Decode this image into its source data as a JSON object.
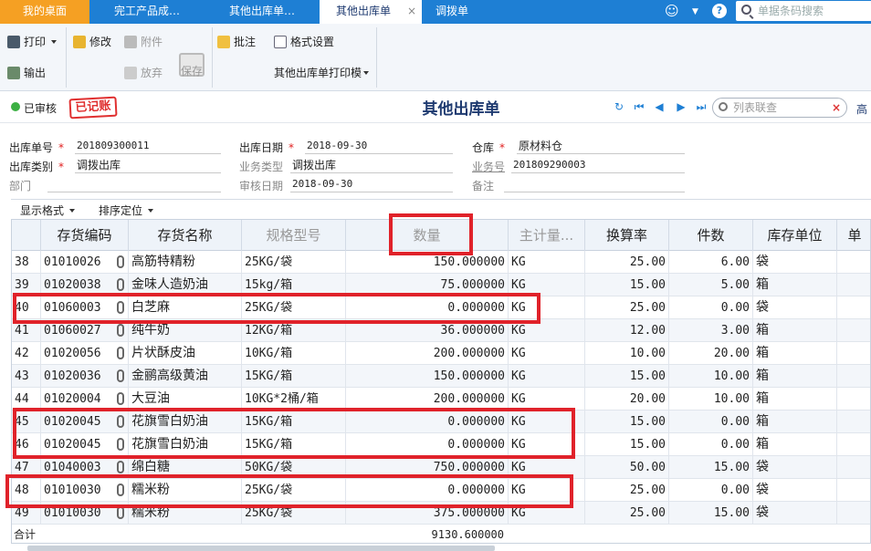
{
  "tabs": [
    {
      "label": "我的桌面"
    },
    {
      "label": "完工产品成…"
    },
    {
      "label": "其他出库单…"
    },
    {
      "label": "其他出库单"
    },
    {
      "label": "调拨单"
    }
  ],
  "top_search_placeholder": "单据条码搜索",
  "toolbar": {
    "print": "打印",
    "edit": "修改",
    "attach": "附件",
    "save": "保存",
    "annotate": "批注",
    "format": "格式设置",
    "output": "输出",
    "discard": "放弃",
    "print_template": "其他出库单打印模"
  },
  "status": {
    "audited": "已审核",
    "stamp": "已记账",
    "title": "其他出库单",
    "link_search_placeholder": "列表联查",
    "right_cut": "高"
  },
  "form": {
    "doc_no_label": "出库单号",
    "doc_no": "201809300011",
    "date_label": "出库日期",
    "date": "2018-09-30",
    "warehouse_label": "仓库",
    "warehouse": "原材料仓",
    "type_label": "出库类别",
    "type": "调拨出库",
    "biz_type_label": "业务类型",
    "biz_type": "调拨出库",
    "biz_no_label": "业务号",
    "biz_no": "201809290003",
    "dept_label": "部门",
    "dept": "",
    "audit_date_label": "审核日期",
    "audit_date": "2018-09-30",
    "note_label": "备注",
    "note": ""
  },
  "grid_tools": {
    "display_format": "显示格式",
    "sort_locate": "排序定位"
  },
  "columns": [
    "",
    "存货编码",
    "存货名称",
    "规格型号",
    "数量",
    "主计量...",
    "换算率",
    "件数",
    "库存单位",
    "单"
  ],
  "rows": [
    {
      "no": "38",
      "code": "01010026",
      "name": "高筋特精粉",
      "spec": "25KG/袋",
      "qty": "150.000000",
      "unit": "KG",
      "rate": "25.00",
      "pieces": "6.00",
      "stock_unit": "袋"
    },
    {
      "no": "39",
      "code": "01020038",
      "name": "金味人造奶油",
      "spec": "15kg/箱",
      "qty": "75.000000",
      "unit": "KG",
      "rate": "15.00",
      "pieces": "5.00",
      "stock_unit": "箱"
    },
    {
      "no": "40",
      "code": "01060003",
      "name": "白芝麻",
      "spec": "25KG/袋",
      "qty": "0.000000",
      "unit": "KG",
      "rate": "25.00",
      "pieces": "0.00",
      "stock_unit": "袋"
    },
    {
      "no": "41",
      "code": "01060027",
      "name": "纯牛奶",
      "spec": "12KG/箱",
      "qty": "36.000000",
      "unit": "KG",
      "rate": "12.00",
      "pieces": "3.00",
      "stock_unit": "箱"
    },
    {
      "no": "42",
      "code": "01020056",
      "name": "片状酥皮油",
      "spec": "10KG/箱",
      "qty": "200.000000",
      "unit": "KG",
      "rate": "10.00",
      "pieces": "20.00",
      "stock_unit": "箱"
    },
    {
      "no": "43",
      "code": "01020036",
      "name": "金鹂高级黄油",
      "spec": "15KG/箱",
      "qty": "150.000000",
      "unit": "KG",
      "rate": "15.00",
      "pieces": "10.00",
      "stock_unit": "箱"
    },
    {
      "no": "44",
      "code": "01020004",
      "name": "大豆油",
      "spec": "10KG*2桶/箱",
      "qty": "200.000000",
      "unit": "KG",
      "rate": "20.00",
      "pieces": "10.00",
      "stock_unit": "箱"
    },
    {
      "no": "45",
      "code": "01020045",
      "name": "花旗雪白奶油",
      "spec": "15KG/箱",
      "qty": "0.000000",
      "unit": "KG",
      "rate": "15.00",
      "pieces": "0.00",
      "stock_unit": "箱"
    },
    {
      "no": "46",
      "code": "01020045",
      "name": "花旗雪白奶油",
      "spec": "15KG/箱",
      "qty": "0.000000",
      "unit": "KG",
      "rate": "15.00",
      "pieces": "0.00",
      "stock_unit": "箱"
    },
    {
      "no": "47",
      "code": "01040003",
      "name": "绵白糖",
      "spec": "50KG/袋",
      "qty": "750.000000",
      "unit": "KG",
      "rate": "50.00",
      "pieces": "15.00",
      "stock_unit": "袋"
    },
    {
      "no": "48",
      "code": "01010030",
      "name": "糯米粉",
      "spec": "25KG/袋",
      "qty": "0.000000",
      "unit": "KG",
      "rate": "25.00",
      "pieces": "0.00",
      "stock_unit": "袋"
    },
    {
      "no": "49",
      "code": "01010030",
      "name": "糯米粉",
      "spec": "25KG/袋",
      "qty": "375.000000",
      "unit": "KG",
      "rate": "25.00",
      "pieces": "15.00",
      "stock_unit": "袋"
    }
  ],
  "total": {
    "label": "合计",
    "qty": "9130.600000"
  },
  "colors": {
    "accent": "#1e7fd4",
    "home_tab": "#f5a023",
    "highlight": "#e0222a"
  }
}
